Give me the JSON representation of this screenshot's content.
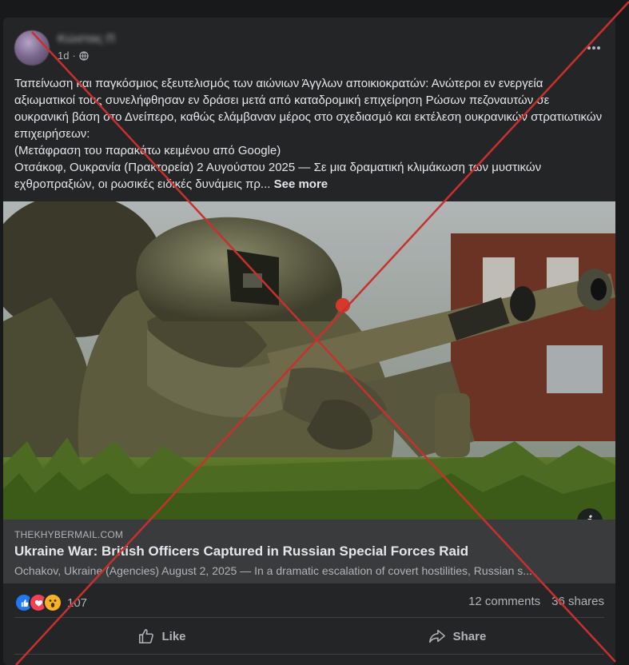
{
  "post": {
    "author_name": "Κώστας Π",
    "time": "1d",
    "separator": "·",
    "text_lines": [
      "Ταπείνωση και παγκόσμιος εξευτελισμός των αιώνιων Άγγλων αποικιοκρατών: Ανώτεροι εν ενεργεία αξιωματικοί τους συνελήφθησαν εν δράσει μετά από καταδρομική επιχείρηση Ρώσων πεζοναυτών σε ουκρανική βάση στο Δνείπερο, καθώς ελάμβαναν μέρος στο σχεδιασμό και εκτέλεση ουκρανικών στρατιωτικών επιχειρήσεων:",
      "(Μετάφραση του παρακάτω κειμένου από Google)",
      "Οτσάκοφ, Ουκρανία (Πρακτορεία) 2 Αυγούστου 2025 — Σε μια δραματική κλιμάκωση των μυστικών εχθροπραξιών, οι ρωσικές ειδικές δυνάμεις πρ..."
    ],
    "see_more": "See more"
  },
  "link": {
    "domain": "THEKHYBERMAIL.COM",
    "title": "Ukraine War: British Officers Captured in Russian Special Forces Raid",
    "description": "Ochakov, Ukraine (Agencies) August 2, 2025 — In a dramatic escalation of covert hostilities, Russian s..."
  },
  "stats": {
    "reaction_count": "107",
    "comments": "12 comments",
    "shares": "36 shares",
    "reaction_icons": [
      "like-icon",
      "love-icon",
      "wow-icon"
    ]
  },
  "actions": {
    "like": "Like",
    "share": "Share"
  },
  "icons": {
    "info": "info-icon",
    "more": "more-options-icon",
    "audience": "globe-icon"
  },
  "colors": {
    "background": "#18191a",
    "card": "#242526",
    "link_bg": "#3a3b3c",
    "cross": "#c8302e",
    "like_blue": "#2078f4",
    "love_red": "#f33e58",
    "wow_yellow": "#f7b125"
  }
}
